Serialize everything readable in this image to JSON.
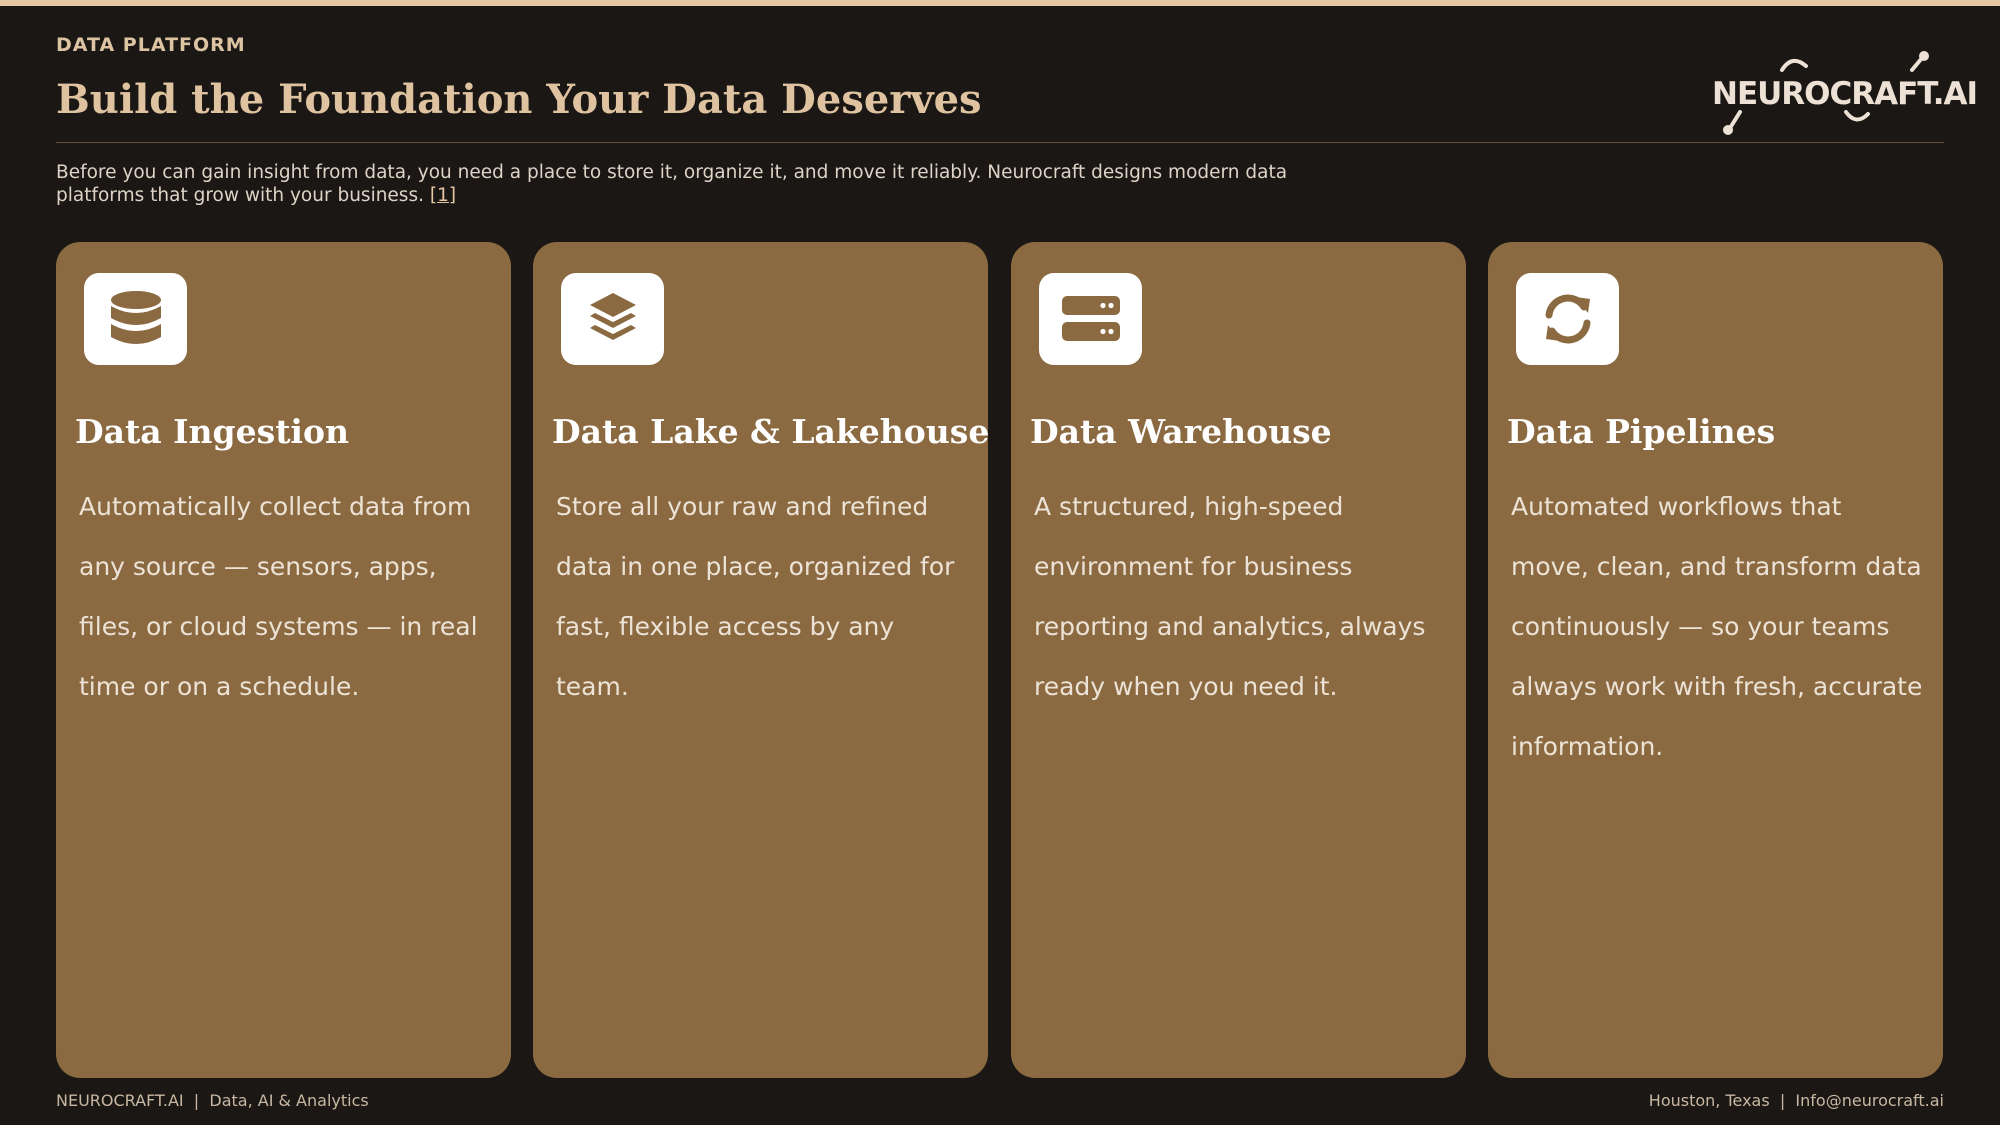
{
  "header": {
    "eyebrow": "DATA PLATFORM",
    "title": "Build the Foundation Your Data Deserves",
    "intro": "Before you can gain insight from data, you need a place to store it, organize it, and move it reliably. Neurocraft designs modern data platforms that grow with your business.",
    "citation": "[1]"
  },
  "logo": {
    "text": "NEUROCRAFT.AI"
  },
  "cards": [
    {
      "icon": "database-icon",
      "title": "Data Ingestion",
      "description": "Automatically collect data from any source — sensors, apps, files, or cloud systems — in real time or on a schedule."
    },
    {
      "icon": "layers-icon",
      "title": "Data Lake & Lakehouse",
      "description": "Store all your raw and refined data in one place, organized for fast, flexible access by any team."
    },
    {
      "icon": "server-icon",
      "title": "Data Warehouse",
      "description": "A structured, high-speed environment for business reporting and analytics, always ready when you need it."
    },
    {
      "icon": "sync-icon",
      "title": "Data Pipelines",
      "description": "Automated workflows that move, clean, and transform data continuously — so your teams always work with fresh, accurate information."
    }
  ],
  "footer": {
    "left": "NEUROCRAFT.AI  |  Data, AI & Analytics",
    "right": "Houston, Texas  |  Info@neurocraft.ai"
  },
  "colors": {
    "background": "#1a1714",
    "accent": "#e5c7a4",
    "card": "#8b6a42"
  }
}
